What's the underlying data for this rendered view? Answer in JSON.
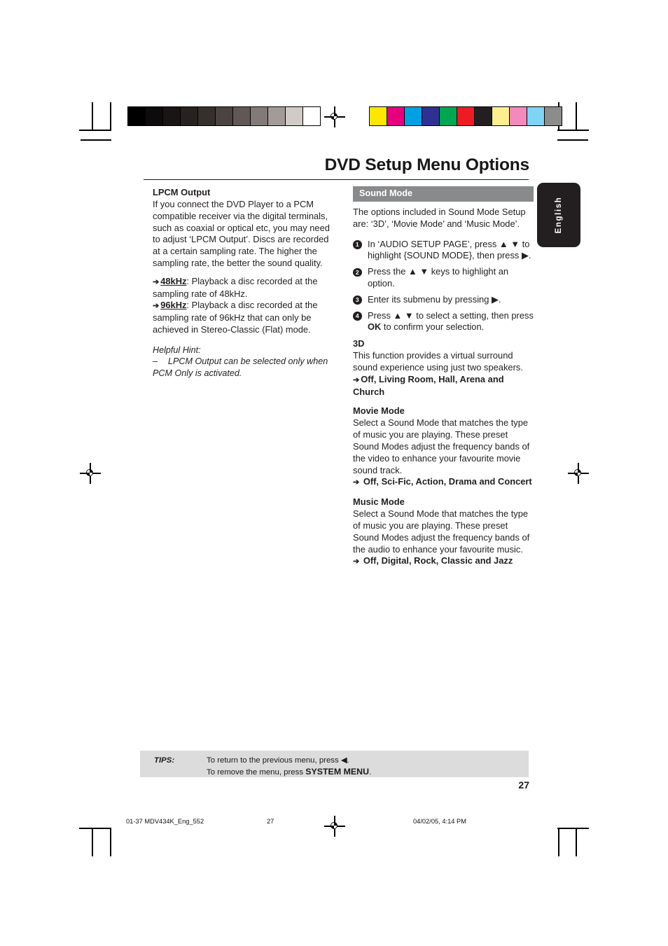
{
  "header": {
    "title": "DVD Setup Menu Options",
    "language_tab": "English"
  },
  "left_column": {
    "section_title": "LPCM Output",
    "paragraph": "If you connect the DVD Player to a PCM compatible receiver via the digital terminals, such as coaxial or optical etc, you may need to adjust ‘LPCM Output’. Discs are recorded at a certain sampling rate. The higher the sampling rate, the better the sound quality.",
    "options": [
      {
        "arrow": "➔",
        "term": "48kHz",
        "description": ": Playback a disc recorded at the sampling rate of 48kHz."
      },
      {
        "arrow": "➔",
        "term": "96kHz",
        "description": ": Playback a disc recorded at the sampling rate of 96kHz that can only be achieved in Stereo-Classic (Flat) mode."
      }
    ],
    "hint_title": "Helpful Hint:",
    "hint_dash": "–",
    "hint_text": "LPCM Output can be selected only when PCM Only is activated."
  },
  "right_column": {
    "banner": "Sound Mode",
    "intro": "The options included in Sound Mode Setup are: ‘3D’, ‘Movie Mode’ and ‘Music Mode’.",
    "steps": [
      {
        "num": "1",
        "text_a": "In ‘AUDIO SETUP PAGE’, press ",
        "keys": "▲ ▼",
        "text_b": " to highlight {SOUND MODE}, then press ▶."
      },
      {
        "num": "2",
        "text_a": "Press the ",
        "keys": "▲ ▼",
        "text_b": " keys to highlight an option."
      },
      {
        "num": "3",
        "text_a": "Enter its submenu by pressing ▶.",
        "keys": "",
        "text_b": ""
      },
      {
        "num": "4",
        "text_a": "Press ",
        "keys": "▲ ▼",
        "text_b": " to select a setting, then press ",
        "bold_key": "OK",
        "text_c": " to confirm your selection."
      }
    ],
    "sections": [
      {
        "title": "3D",
        "body": "This function provides a virtual surround sound experience using just two speakers.",
        "arrow": "➔",
        "options": "Off, Living Room, Hall, Arena and Church"
      },
      {
        "title": "Movie Mode",
        "body": "Select a Sound Mode that matches the type of music you are playing. These preset Sound Modes adjust the frequency bands of the video to enhance your favourite movie sound track.",
        "arrow": "➔",
        "options": "Off, Sci-Fic, Action, Drama and Concert"
      },
      {
        "title": "Music Mode",
        "body": "Select a Sound Mode that matches the type of music you are playing. These preset Sound Modes adjust the frequency bands of the audio to enhance your favourite music.",
        "arrow": "➔",
        "options": "Off, Digital, Rock, Classic and Jazz"
      }
    ]
  },
  "footer": {
    "tips_label": "TIPS:",
    "tips_line1": "To return to the previous menu, press ◀.",
    "tips_line2_a": "To remove the menu, press ",
    "tips_line2_b": "SYSTEM MENU",
    "tips_line2_c": ".",
    "page_number": "27",
    "slug_file": "01-37 MDV434K_Eng_552",
    "slug_page": "27",
    "slug_date": "04/02/05, 4:14 PM"
  },
  "press_marks": {
    "grayscale_swatches": [
      "#000000",
      "#0d0b0b",
      "#191514",
      "#27211f",
      "#36302d",
      "#4b433f",
      "#615856",
      "#827a78",
      "#a39b98",
      "#d2cac6",
      "#ffffff"
    ],
    "color_swatches": [
      "#ffe600",
      "#e6007e",
      "#00a0e3",
      "#2e3192",
      "#00a651",
      "#ed1c24",
      "#231f20",
      "#fdee8f",
      "#f489bd",
      "#7fd4f5",
      "#8c8c8c"
    ]
  }
}
